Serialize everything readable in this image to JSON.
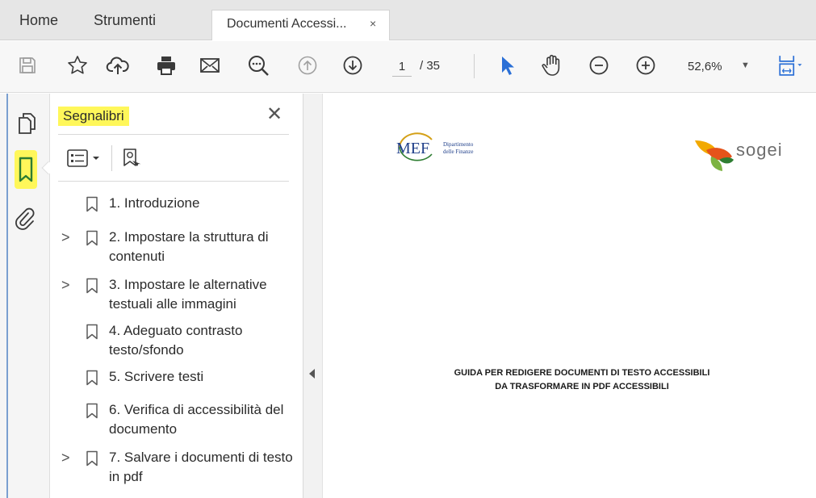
{
  "tabs": {
    "home": "Home",
    "tools": "Strumenti",
    "document": "Documenti Accessi...",
    "close_glyph": "×"
  },
  "toolbar": {
    "icons": [
      "save-icon",
      "star-icon",
      "cloud-upload-icon",
      "printer-icon",
      "mail-icon",
      "search-icon",
      "page-up-icon",
      "page-down-icon",
      "select-cursor-icon",
      "hand-tool-icon",
      "zoom-out-icon",
      "zoom-in-icon",
      "fit-page-icon"
    ],
    "page_current": "1",
    "page_total": "/ 35",
    "zoom": "52,6%"
  },
  "rail": {
    "icons": [
      "pages-icon",
      "bookmark-icon",
      "attachment-icon"
    ],
    "highlight_color": "#fff75a"
  },
  "panel": {
    "title": "Segnalibri",
    "close_glyph": "✕",
    "bookmarks": [
      {
        "label": "1. Introduzione",
        "expandable": false
      },
      {
        "label": "2. Impostare la struttura di contenuti",
        "expandable": true
      },
      {
        "label": "3. Impostare le alternative testuali alle immagini",
        "expandable": true
      },
      {
        "label": "4. Adeguato contrasto testo/sfondo",
        "expandable": false
      },
      {
        "label": "5. Scrivere testi",
        "expandable": false
      },
      {
        "label": "6. Verifica di accessibilità del documento",
        "expandable": false
      },
      {
        "label": "7. Salvare i documenti di testo in pdf",
        "expandable": true
      }
    ]
  },
  "document": {
    "mef_mark": "MEF",
    "mef_caption_line1": "Dipartimento",
    "mef_caption_line2": "delle Finanze",
    "sogei_name": "sogei",
    "title_line1": "GUIDA PER REDIGERE DOCUMENTI DI TESTO ACCESSIBILI",
    "title_line2": "DA TRASFORMARE IN PDF ACCESSIBILI"
  },
  "colors": {
    "accent_blue": "#2a6fd6",
    "icon_gray": "#3a3a3a",
    "highlight_yellow": "#fff75a",
    "bookmark_green": "#2e7d32"
  }
}
